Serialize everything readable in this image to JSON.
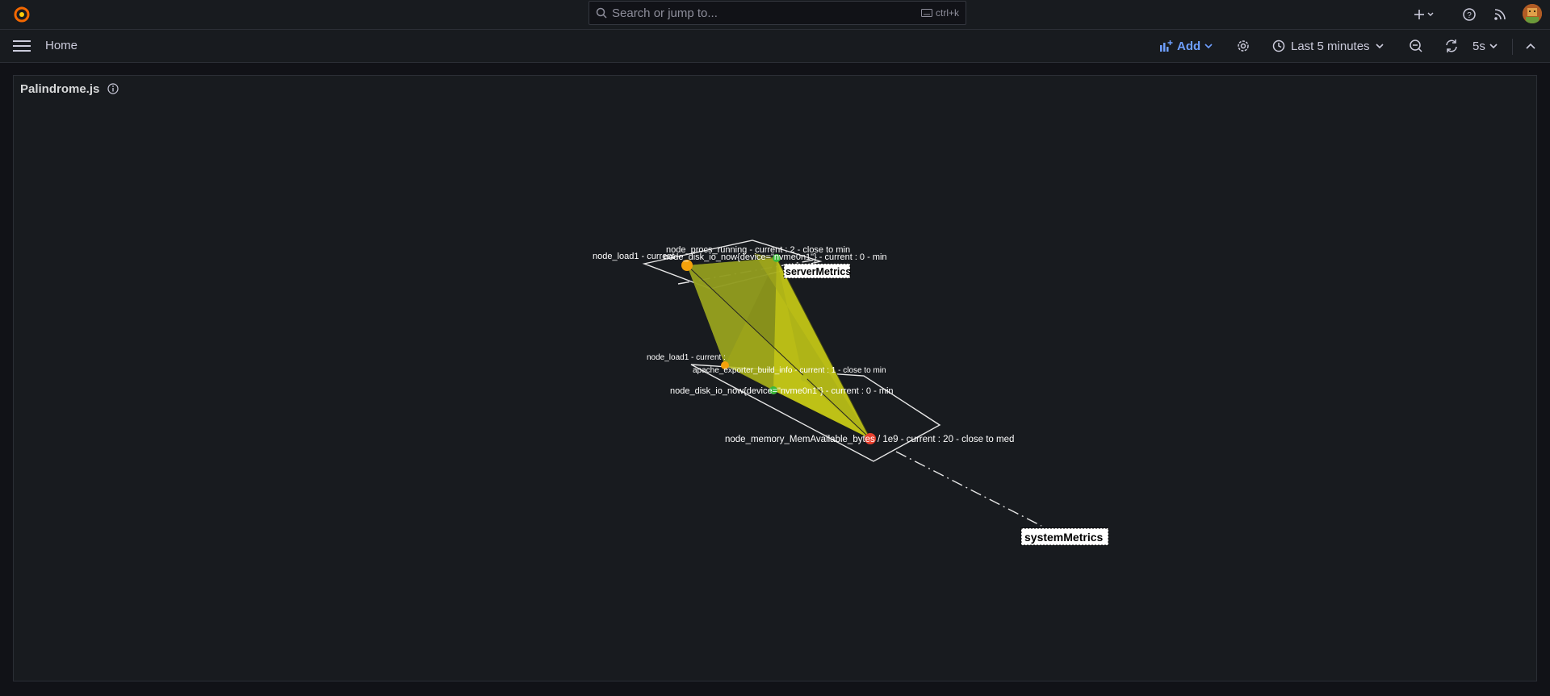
{
  "topbar": {
    "search_placeholder": "Search or jump to...",
    "search_shortcut": "ctrl+k",
    "icons": [
      "grafana-logo-icon",
      "search-icon",
      "keyboard-icon",
      "plus-icon",
      "help-icon",
      "rss-icon",
      "avatar"
    ]
  },
  "subbar": {
    "breadcrumb": "Home",
    "add_label": "Add",
    "time_range": "Last 5 minutes",
    "refresh_interval": "5s"
  },
  "panel": {
    "title": "Palindrome.js",
    "layers": [
      {
        "name": "serverMetrics"
      },
      {
        "name": "systemMetrics"
      }
    ],
    "metric_labels": [
      "node_procs_running - current : 2  - close to min",
      "node_load1 - current",
      "node_disk_io_now{device=\"nvme0n1\"} - current : 0  - min",
      "node_load1 - current : ",
      "apache_exporter_build_info - current : 1  - close to min",
      "node_disk_io_now{device=\"nvme0n1\"} - current : 0  - min",
      "node_memory_MemAvailable_bytes / 1e9 - current : 20  - close to med"
    ]
  },
  "colors": {
    "background": "#111217",
    "panel": "#181b1f",
    "accent": "#6e9fff",
    "shape_fill": "#a8b316",
    "orange_point": "#f5a10b",
    "green_point": "#3cb93c",
    "red_point": "#e8402e"
  }
}
